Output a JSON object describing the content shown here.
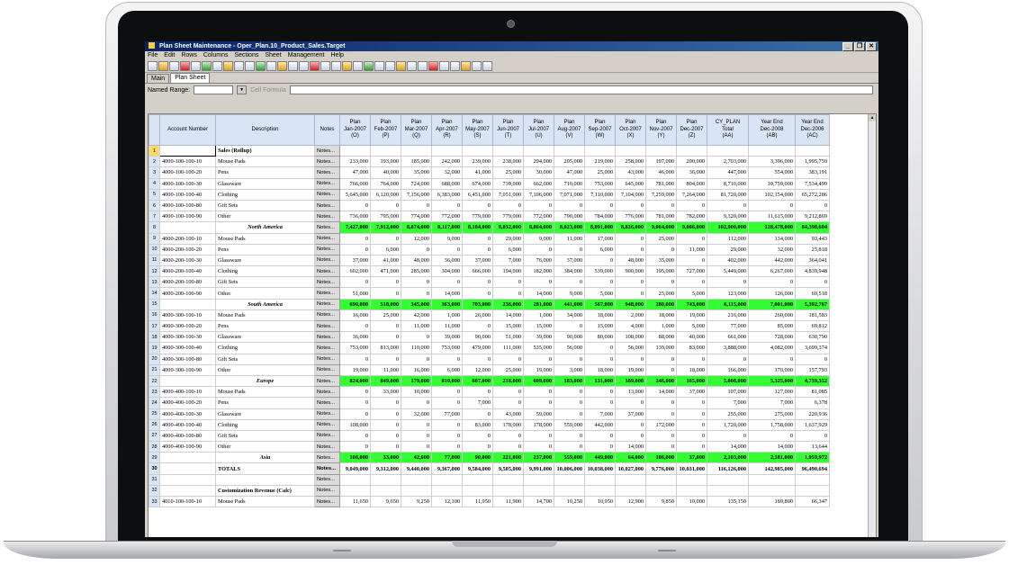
{
  "window": {
    "title": "Plan Sheet Maintenance - Oper_Plan.10_Product_Sales.Target",
    "controls": [
      "_",
      "❐",
      "✕"
    ]
  },
  "menu": [
    "File",
    "Edit",
    "Rows",
    "Columns",
    "Sections",
    "Sheet",
    "Management",
    "Help"
  ],
  "tabs": [
    "Main",
    "Plan Sheet"
  ],
  "named_range": {
    "label": "Named Range:",
    "value": "",
    "cell_formula_label": "Cell Formula"
  },
  "grid": {
    "headers": {
      "account": "Account Number",
      "description": "Description",
      "notes": "Notes",
      "months": [
        [
          "Plan",
          "Jan-2007",
          "(O)"
        ],
        [
          "Plan",
          "Feb-2007",
          "(P)"
        ],
        [
          "Plan",
          "Mar-2007",
          "(Q)"
        ],
        [
          "Plan",
          "Apr-2007",
          "(R)"
        ],
        [
          "Plan",
          "May-2007",
          "(S)"
        ],
        [
          "Plan",
          "Jun-2007",
          "(T)"
        ],
        [
          "Plan",
          "Jul-2007",
          "(U)"
        ],
        [
          "Plan",
          "Aug-2007",
          "(V)"
        ],
        [
          "Plan",
          "Sep-2007",
          "(W)"
        ],
        [
          "Plan",
          "Oct-2007",
          "(X)"
        ],
        [
          "Plan",
          "Nov-2007",
          "(Y)"
        ],
        [
          "Plan",
          "Dec-2007",
          "(Z)"
        ],
        [
          "CY_PLAN",
          "Total",
          "(AA)"
        ],
        [
          "Year End",
          "Dec-2008",
          "(AB)"
        ],
        [
          "Year End",
          "Dec-2006",
          "(AC)"
        ]
      ]
    },
    "notes_label": "Notes...",
    "rows": [
      {
        "n": "1",
        "acct": "",
        "desc": "Sales (Rollup)",
        "type": "section",
        "vals": []
      },
      {
        "n": "2",
        "acct": "4000-100-100-10",
        "desc": "Mouse Pads",
        "type": "data",
        "vals": [
          "233,000",
          "193,000",
          "185,000",
          "242,000",
          "239,000",
          "238,000",
          "294,000",
          "205,000",
          "219,000",
          "258,000",
          "197,000",
          "200,000",
          "2,703,000",
          "3,396,000",
          "1,995,759"
        ]
      },
      {
        "n": "3",
        "acct": "4000-100-100-20",
        "desc": "Pens",
        "type": "data",
        "vals": [
          "47,000",
          "40,000",
          "35,000",
          "32,000",
          "41,000",
          "25,000",
          "30,000",
          "47,000",
          "25,000",
          "43,000",
          "46,000",
          "36,000",
          "447,000",
          "554,000",
          "383,191"
        ]
      },
      {
        "n": "4",
        "acct": "4000-100-100-30",
        "desc": "Glassware",
        "type": "data",
        "vals": [
          "766,000",
          "764,000",
          "724,000",
          "688,000",
          "674,000",
          "739,000",
          "662,000",
          "710,000",
          "753,000",
          "645,000",
          "781,000",
          "804,000",
          "8,710,000",
          "10,759,000",
          "7,534,499"
        ]
      },
      {
        "n": "5",
        "acct": "4000-100-100-40",
        "desc": "Clothing",
        "type": "data",
        "vals": [
          "5,645,000",
          "6,120,000",
          "7,156,000",
          "6,383,000",
          "6,451,000",
          "7,051,000",
          "7,106,000",
          "7,071,000",
          "7,110,000",
          "7,104,000",
          "7,259,000",
          "7,264,000",
          "81,720,000",
          "102,154,000",
          "65,272,286"
        ]
      },
      {
        "n": "6",
        "acct": "4000-100-100-80",
        "desc": "Gift Sets",
        "type": "data",
        "vals": [
          "0",
          "0",
          "0",
          "0",
          "0",
          "0",
          "0",
          "0",
          "0",
          "0",
          "0",
          "0",
          "0",
          "0",
          "0"
        ]
      },
      {
        "n": "7",
        "acct": "4000-100-100-90",
        "desc": "Other",
        "type": "data",
        "vals": [
          "736,000",
          "795,000",
          "774,000",
          "772,000",
          "779,000",
          "779,000",
          "772,000",
          "790,000",
          "784,000",
          "776,000",
          "781,000",
          "782,000",
          "9,320,000",
          "11,615,000",
          "9,212,869"
        ]
      },
      {
        "n": "8",
        "acct": "",
        "desc": "North America",
        "type": "subtotal",
        "vals": [
          "7,427,000",
          "7,912,000",
          "8,874,000",
          "8,117,000",
          "8,184,000",
          "8,832,000",
          "8,864,000",
          "8,823,000",
          "8,891,000",
          "8,826,000",
          "9,064,000",
          "9,086,000",
          "102,900,000",
          "128,478,000",
          "84,398,604"
        ]
      },
      {
        "n": "9",
        "acct": "4000-200-100-10",
        "desc": "Mouse Pads",
        "type": "data",
        "vals": [
          "0",
          "0",
          "12,000",
          "9,000",
          "0",
          "29,000",
          "9,000",
          "11,000",
          "17,000",
          "0",
          "25,000",
          "0",
          "112,000",
          "134,000",
          "93,443"
        ]
      },
      {
        "n": "10",
        "acct": "4000-200-100-20",
        "desc": "Pens",
        "type": "data",
        "vals": [
          "0",
          "6,000",
          "0",
          "0",
          "0",
          "6,000",
          "0",
          "0",
          "6,000",
          "0",
          "0",
          "11,000",
          "29,000",
          "32,000",
          "25,818"
        ]
      },
      {
        "n": "11",
        "acct": "4000-200-100-30",
        "desc": "Glassware",
        "type": "data",
        "vals": [
          "37,000",
          "41,000",
          "48,000",
          "36,000",
          "37,000",
          "7,000",
          "76,000",
          "37,000",
          "0",
          "48,000",
          "35,000",
          "0",
          "402,000",
          "442,000",
          "364,041"
        ]
      },
      {
        "n": "12",
        "acct": "4000-200-100-40",
        "desc": "Clothing",
        "type": "data",
        "vals": [
          "602,000",
          "471,000",
          "285,000",
          "304,000",
          "666,000",
          "194,000",
          "182,000",
          "384,000",
          "539,000",
          "900,000",
          "195,000",
          "727,000",
          "5,449,000",
          "6,267,000",
          "4,839,948"
        ]
      },
      {
        "n": "13",
        "acct": "4000-200-100-80",
        "desc": "Gift Sets",
        "type": "data",
        "vals": [
          "0",
          "0",
          "0",
          "0",
          "0",
          "0",
          "0",
          "0",
          "0",
          "0",
          "0",
          "0",
          "0",
          "0",
          "0"
        ]
      },
      {
        "n": "14",
        "acct": "4000-200-100-90",
        "desc": "Other",
        "type": "data",
        "vals": [
          "51,000",
          "0",
          "0",
          "14,000",
          "0",
          "0",
          "14,000",
          "9,000",
          "5,000",
          "0",
          "25,000",
          "5,000",
          "123,000",
          "126,000",
          "69,518"
        ]
      },
      {
        "n": "15",
        "acct": "",
        "desc": "South America",
        "type": "subtotal",
        "vals": [
          "690,000",
          "518,000",
          "345,000",
          "363,000",
          "703,000",
          "236,000",
          "281,000",
          "441,000",
          "567,000",
          "948,000",
          "280,000",
          "743,000",
          "6,115,000",
          "7,001,000",
          "5,392,767"
        ]
      },
      {
        "n": "16",
        "acct": "4000-300-100-10",
        "desc": "Mouse Pads",
        "type": "data",
        "vals": [
          "16,000",
          "25,000",
          "42,000",
          "1,000",
          "26,000",
          "14,000",
          "1,000",
          "34,000",
          "18,000",
          "2,000",
          "18,000",
          "19,000",
          "216,000",
          "260,000",
          "181,583"
        ]
      },
      {
        "n": "17",
        "acct": "4000-300-100-20",
        "desc": "Pens",
        "type": "data",
        "vals": [
          "0",
          "0",
          "11,000",
          "11,000",
          "0",
          "15,000",
          "15,000",
          "0",
          "15,000",
          "4,000",
          "1,000",
          "5,000",
          "77,000",
          "85,000",
          "69,812"
        ]
      },
      {
        "n": "18",
        "acct": "4000-300-100-30",
        "desc": "Glassware",
        "type": "data",
        "vals": [
          "36,000",
          "0",
          "0",
          "39,000",
          "90,000",
          "51,000",
          "39,000",
          "90,000",
          "80,000",
          "108,000",
          "88,000",
          "40,000",
          "661,000",
          "728,000",
          "630,790"
        ]
      },
      {
        "n": "19",
        "acct": "4000-300-100-40",
        "desc": "Clothing",
        "type": "data",
        "vals": [
          "753,000",
          "813,000",
          "110,000",
          "753,000",
          "479,000",
          "111,000",
          "535,000",
          "56,000",
          "0",
          "56,000",
          "139,000",
          "83,000",
          "3,888,000",
          "4,082,000",
          "3,699,374"
        ]
      },
      {
        "n": "20",
        "acct": "4000-300-100-80",
        "desc": "Gift Sets",
        "type": "data",
        "vals": [
          "0",
          "0",
          "0",
          "0",
          "0",
          "0",
          "0",
          "0",
          "0",
          "0",
          "0",
          "0",
          "0",
          "0",
          "0"
        ]
      },
      {
        "n": "21",
        "acct": "4000-300-100-90",
        "desc": "Other",
        "type": "data",
        "vals": [
          "19,000",
          "11,000",
          "16,000",
          "6,000",
          "12,000",
          "25,000",
          "19,000",
          "3,000",
          "18,000",
          "19,000",
          "0",
          "18,000",
          "166,000",
          "170,000",
          "157,793"
        ]
      },
      {
        "n": "22",
        "acct": "",
        "desc": "Europe",
        "type": "subtotal",
        "vals": [
          "824,000",
          "849,000",
          "179,000",
          "810,000",
          "607,000",
          "216,000",
          "609,000",
          "183,000",
          "131,000",
          "189,000",
          "246,000",
          "165,000",
          "5,008,000",
          "5,325,000",
          "4,739,352"
        ]
      },
      {
        "n": "23",
        "acct": "4000-400-100-10",
        "desc": "Mouse Pads",
        "type": "data",
        "vals": [
          "0",
          "33,000",
          "10,000",
          "0",
          "0",
          "0",
          "0",
          "0",
          "0",
          "13,000",
          "14,000",
          "37,000",
          "107,000",
          "127,000",
          "81,085"
        ]
      },
      {
        "n": "24",
        "acct": "4000-400-100-20",
        "desc": "Pens",
        "type": "data",
        "vals": [
          "0",
          "0",
          "0",
          "0",
          "7,000",
          "0",
          "0",
          "0",
          "0",
          "0",
          "0",
          "0",
          "7,000",
          "7,000",
          "6,378"
        ]
      },
      {
        "n": "25",
        "acct": "4000-400-100-30",
        "desc": "Glassware",
        "type": "data",
        "vals": [
          "0",
          "0",
          "32,000",
          "77,000",
          "0",
          "43,000",
          "59,000",
          "0",
          "7,000",
          "37,000",
          "0",
          "0",
          "255,000",
          "275,000",
          "220,936"
        ]
      },
      {
        "n": "26",
        "acct": "4000-400-100-40",
        "desc": "Clothing",
        "type": "data",
        "vals": [
          "108,000",
          "0",
          "0",
          "0",
          "83,000",
          "178,000",
          "178,000",
          "559,000",
          "442,000",
          "0",
          "172,000",
          "0",
          "1,720,000",
          "1,758,000",
          "1,637,929"
        ]
      },
      {
        "n": "27",
        "acct": "4000-400-100-80",
        "desc": "Gift Sets",
        "type": "data",
        "vals": [
          "0",
          "0",
          "0",
          "0",
          "0",
          "0",
          "0",
          "0",
          "0",
          "0",
          "0",
          "0",
          "0",
          "0",
          "0"
        ]
      },
      {
        "n": "28",
        "acct": "4000-400-100-90",
        "desc": "Other",
        "type": "data",
        "vals": [
          "0",
          "0",
          "0",
          "0",
          "0",
          "0",
          "0",
          "0",
          "0",
          "14,000",
          "0",
          "0",
          "14,000",
          "14,000",
          "13,644"
        ]
      },
      {
        "n": "29",
        "acct": "",
        "desc": "Asia",
        "type": "subtotal",
        "vals": [
          "108,000",
          "33,000",
          "42,000",
          "77,000",
          "90,000",
          "221,000",
          "237,000",
          "559,000",
          "449,000",
          "64,000",
          "186,000",
          "37,000",
          "2,103,000",
          "2,181,000",
          "1,959,972"
        ]
      },
      {
        "n": "30",
        "acct": "",
        "desc": "TOTALS",
        "type": "total",
        "vals": [
          "9,049,000",
          "9,312,000",
          "9,440,000",
          "9,367,000",
          "9,584,000",
          "9,505,000",
          "9,991,000",
          "10,006,000",
          "10,038,000",
          "10,027,000",
          "9,776,000",
          "10,031,000",
          "116,126,000",
          "142,985,000",
          "96,490,694"
        ]
      },
      {
        "n": "31",
        "acct": "",
        "desc": "",
        "type": "blank",
        "vals": []
      },
      {
        "n": "32",
        "acct": "",
        "desc": "Customization Revenue (Calc)",
        "type": "section",
        "vals": []
      },
      {
        "n": "33",
        "acct": "4010-100-100-10",
        "desc": "Mouse Pads",
        "type": "data",
        "vals": [
          "11,650",
          "9,650",
          "9,250",
          "12,100",
          "11,950",
          "11,900",
          "14,700",
          "10,250",
          "10,950",
          "12,900",
          "9,850",
          "10,000",
          "135,150",
          "169,800",
          "66,347"
        ]
      }
    ]
  }
}
